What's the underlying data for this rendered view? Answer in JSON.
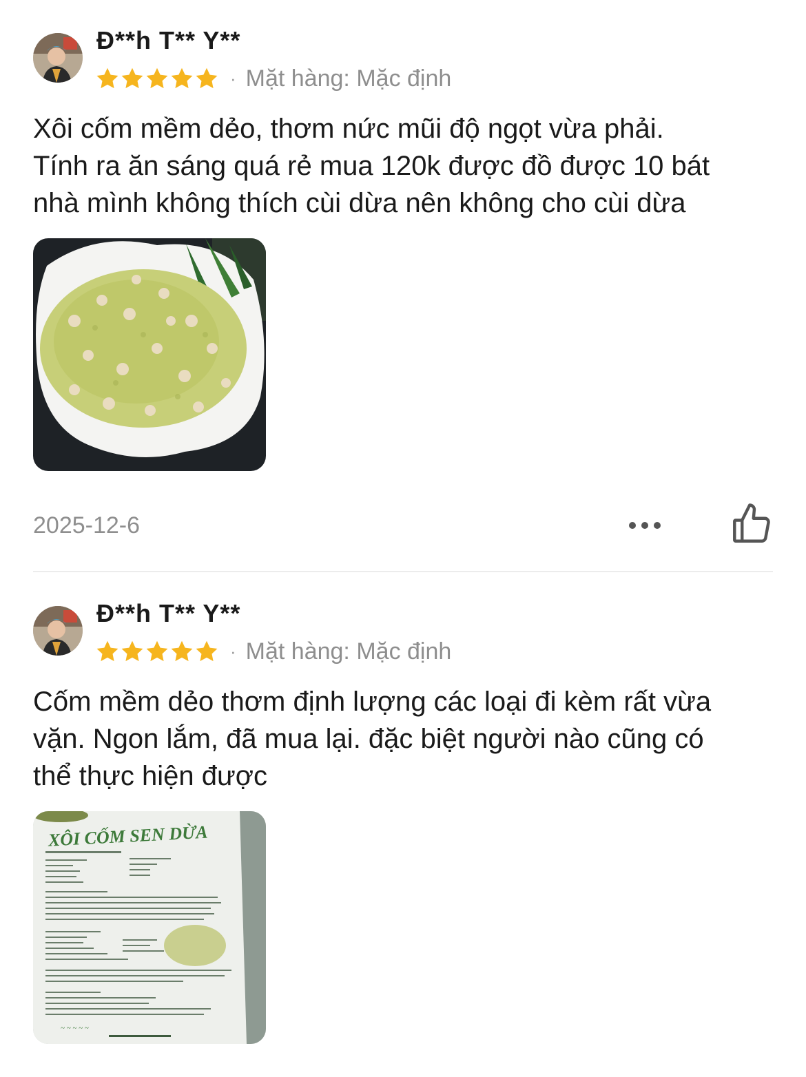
{
  "reviews": [
    {
      "username": "Đ**h T** Y**",
      "rating": 5,
      "variant_label": "Mặt hàng:",
      "variant_value": "Mặc định",
      "text_lines": [
        "Xôi cốm mềm dẻo, thơm nức mũi độ ngọt vừa phải.",
        "Tính ra ăn sáng quá rẻ mua 120k được  đồ được 10 bát",
        "nhà mình không thích cùi dừa nên không cho cùi dừa"
      ],
      "date": "2025-12-6"
    },
    {
      "username": "Đ**h T** Y**",
      "rating": 5,
      "variant_label": "Mặt hàng:",
      "variant_value": "Mặc định",
      "text_lines": [
        "Cốm mềm dẻo thơm định lượng các loại đi kèm rất vừa",
        "vặn. Ngon lắm, đã mua lại.  đặc biệt người nào cũng có",
        "thể thực hiện được"
      ],
      "package_title": "XÔI CỐM SEN DỪA"
    }
  ],
  "icons": {
    "star": "star-icon",
    "more": "more-icon",
    "like": "thumbs-up-icon"
  },
  "colors": {
    "star": "#f6b51e",
    "muted_text": "#8e8e8e",
    "divider": "#ececec"
  }
}
